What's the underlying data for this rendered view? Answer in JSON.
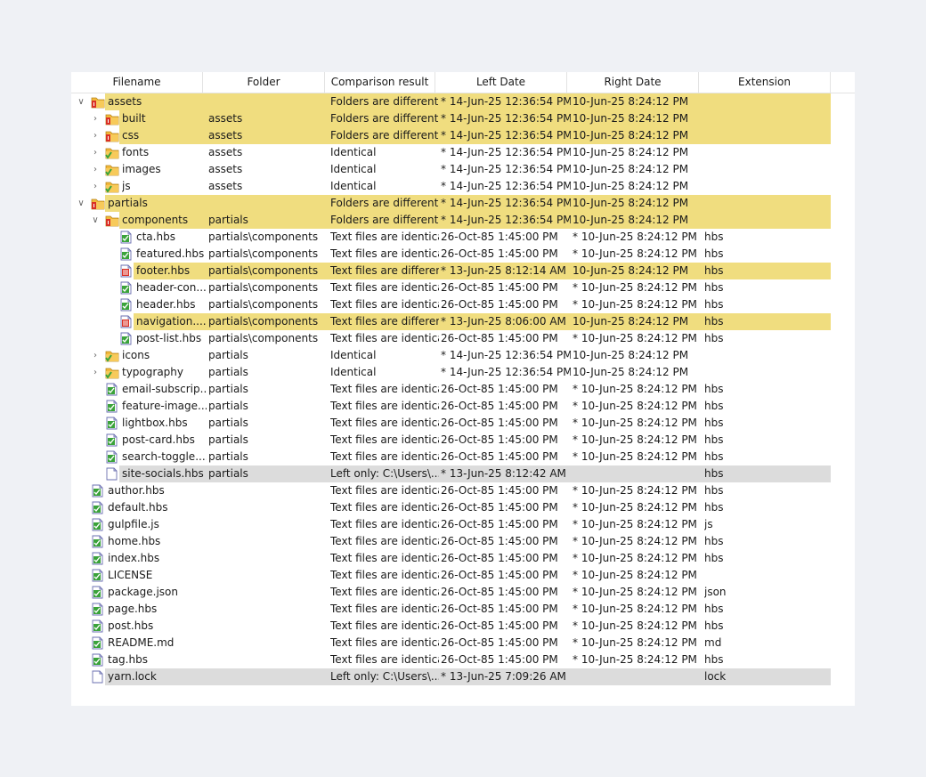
{
  "columns": [
    "Filename",
    "Folder",
    "Comparison result",
    "Left Date",
    "Right Date",
    "Extension"
  ],
  "rows": [
    {
      "level": 0,
      "toggle": "expanded",
      "icon": "folder-diff-icon",
      "name": "assets",
      "folder": "",
      "result": "Folders are different",
      "left": "* 14-Jun-25 12:36:54 PM",
      "right": "10-Jun-25 8:24:12 PM",
      "ext": "",
      "hl": "diff"
    },
    {
      "level": 1,
      "toggle": "collapsed",
      "icon": "folder-diff-icon",
      "name": "built",
      "folder": "assets",
      "result": "Folders are different",
      "left": "* 14-Jun-25 12:36:54 PM",
      "right": "10-Jun-25 8:24:12 PM",
      "ext": "",
      "hl": "diff"
    },
    {
      "level": 1,
      "toggle": "collapsed",
      "icon": "folder-diff-icon",
      "name": "css",
      "folder": "assets",
      "result": "Folders are different",
      "left": "* 14-Jun-25 12:36:54 PM",
      "right": "10-Jun-25 8:24:12 PM",
      "ext": "",
      "hl": "diff"
    },
    {
      "level": 1,
      "toggle": "collapsed",
      "icon": "folder-same-icon",
      "name": "fonts",
      "folder": "assets",
      "result": "Identical",
      "left": "* 14-Jun-25 12:36:54 PM",
      "right": "10-Jun-25 8:24:12 PM",
      "ext": "",
      "hl": ""
    },
    {
      "level": 1,
      "toggle": "collapsed",
      "icon": "folder-same-icon",
      "name": "images",
      "folder": "assets",
      "result": "Identical",
      "left": "* 14-Jun-25 12:36:54 PM",
      "right": "10-Jun-25 8:24:12 PM",
      "ext": "",
      "hl": ""
    },
    {
      "level": 1,
      "toggle": "collapsed",
      "icon": "folder-same-icon",
      "name": "js",
      "folder": "assets",
      "result": "Identical",
      "left": "* 14-Jun-25 12:36:54 PM",
      "right": "10-Jun-25 8:24:12 PM",
      "ext": "",
      "hl": ""
    },
    {
      "level": 0,
      "toggle": "expanded",
      "icon": "folder-diff-icon",
      "name": "partials",
      "folder": "",
      "result": "Folders are different",
      "left": "* 14-Jun-25 12:36:54 PM",
      "right": "10-Jun-25 8:24:12 PM",
      "ext": "",
      "hl": "diff"
    },
    {
      "level": 1,
      "toggle": "expanded",
      "icon": "folder-diff-icon",
      "name": "components",
      "folder": "partials",
      "result": "Folders are different",
      "left": "* 14-Jun-25 12:36:54 PM",
      "right": "10-Jun-25 8:24:12 PM",
      "ext": "",
      "hl": "diff"
    },
    {
      "level": 2,
      "toggle": "none",
      "icon": "file-same-icon",
      "name": "cta.hbs",
      "folder": "partials\\components",
      "result": "Text files are identical",
      "left": "26-Oct-85 1:45:00 PM",
      "right": "* 10-Jun-25 8:24:12 PM",
      "ext": "hbs",
      "hl": ""
    },
    {
      "level": 2,
      "toggle": "none",
      "icon": "file-same-icon",
      "name": "featured.hbs",
      "folder": "partials\\components",
      "result": "Text files are identical",
      "left": "26-Oct-85 1:45:00 PM",
      "right": "* 10-Jun-25 8:24:12 PM",
      "ext": "hbs",
      "hl": ""
    },
    {
      "level": 2,
      "toggle": "none",
      "icon": "file-diff-icon",
      "name": "footer.hbs",
      "folder": "partials\\components",
      "result": "Text files are different",
      "left": "* 13-Jun-25 8:12:14 AM",
      "right": "10-Jun-25 8:24:12 PM",
      "ext": "hbs",
      "hl": "diff"
    },
    {
      "level": 2,
      "toggle": "none",
      "icon": "file-same-icon",
      "name": "header-con...",
      "folder": "partials\\components",
      "result": "Text files are identical",
      "left": "26-Oct-85 1:45:00 PM",
      "right": "* 10-Jun-25 8:24:12 PM",
      "ext": "hbs",
      "hl": ""
    },
    {
      "level": 2,
      "toggle": "none",
      "icon": "file-same-icon",
      "name": "header.hbs",
      "folder": "partials\\components",
      "result": "Text files are identical",
      "left": "26-Oct-85 1:45:00 PM",
      "right": "* 10-Jun-25 8:24:12 PM",
      "ext": "hbs",
      "hl": ""
    },
    {
      "level": 2,
      "toggle": "none",
      "icon": "file-diff-icon",
      "name": "navigation....",
      "folder": "partials\\components",
      "result": "Text files are different",
      "left": "* 13-Jun-25 8:06:00 AM",
      "right": "10-Jun-25 8:24:12 PM",
      "ext": "hbs",
      "hl": "diff"
    },
    {
      "level": 2,
      "toggle": "none",
      "icon": "file-same-icon",
      "name": "post-list.hbs",
      "folder": "partials\\components",
      "result": "Text files are identical",
      "left": "26-Oct-85 1:45:00 PM",
      "right": "* 10-Jun-25 8:24:12 PM",
      "ext": "hbs",
      "hl": ""
    },
    {
      "level": 1,
      "toggle": "collapsed",
      "icon": "folder-same-icon",
      "name": "icons",
      "folder": "partials",
      "result": "Identical",
      "left": "* 14-Jun-25 12:36:54 PM",
      "right": "10-Jun-25 8:24:12 PM",
      "ext": "",
      "hl": ""
    },
    {
      "level": 1,
      "toggle": "collapsed",
      "icon": "folder-same-icon",
      "name": "typography",
      "folder": "partials",
      "result": "Identical",
      "left": "* 14-Jun-25 12:36:54 PM",
      "right": "10-Jun-25 8:24:12 PM",
      "ext": "",
      "hl": ""
    },
    {
      "level": 1,
      "toggle": "none",
      "icon": "file-same-icon",
      "name": "email-subscrip...",
      "folder": "partials",
      "result": "Text files are identical",
      "left": "26-Oct-85 1:45:00 PM",
      "right": "* 10-Jun-25 8:24:12 PM",
      "ext": "hbs",
      "hl": ""
    },
    {
      "level": 1,
      "toggle": "none",
      "icon": "file-same-icon",
      "name": "feature-image....",
      "folder": "partials",
      "result": "Text files are identical",
      "left": "26-Oct-85 1:45:00 PM",
      "right": "* 10-Jun-25 8:24:12 PM",
      "ext": "hbs",
      "hl": ""
    },
    {
      "level": 1,
      "toggle": "none",
      "icon": "file-same-icon",
      "name": "lightbox.hbs",
      "folder": "partials",
      "result": "Text files are identical",
      "left": "26-Oct-85 1:45:00 PM",
      "right": "* 10-Jun-25 8:24:12 PM",
      "ext": "hbs",
      "hl": ""
    },
    {
      "level": 1,
      "toggle": "none",
      "icon": "file-same-icon",
      "name": "post-card.hbs",
      "folder": "partials",
      "result": "Text files are identical",
      "left": "26-Oct-85 1:45:00 PM",
      "right": "* 10-Jun-25 8:24:12 PM",
      "ext": "hbs",
      "hl": ""
    },
    {
      "level": 1,
      "toggle": "none",
      "icon": "file-same-icon",
      "name": "search-toggle....",
      "folder": "partials",
      "result": "Text files are identical",
      "left": "26-Oct-85 1:45:00 PM",
      "right": "* 10-Jun-25 8:24:12 PM",
      "ext": "hbs",
      "hl": ""
    },
    {
      "level": 1,
      "toggle": "none",
      "icon": "file-left-only-icon",
      "name": "site-socials.hbs",
      "folder": "partials",
      "result": "Left only: C:\\Users\\...",
      "left": "* 13-Jun-25 8:12:42 AM",
      "right": "",
      "ext": "hbs",
      "hl": "left"
    },
    {
      "level": 0,
      "toggle": "none",
      "icon": "file-same-icon",
      "name": "author.hbs",
      "folder": "",
      "result": "Text files are identical",
      "left": "26-Oct-85 1:45:00 PM",
      "right": "* 10-Jun-25 8:24:12 PM",
      "ext": "hbs",
      "hl": ""
    },
    {
      "level": 0,
      "toggle": "none",
      "icon": "file-same-icon",
      "name": "default.hbs",
      "folder": "",
      "result": "Text files are identical",
      "left": "26-Oct-85 1:45:00 PM",
      "right": "* 10-Jun-25 8:24:12 PM",
      "ext": "hbs",
      "hl": ""
    },
    {
      "level": 0,
      "toggle": "none",
      "icon": "file-same-icon",
      "name": "gulpfile.js",
      "folder": "",
      "result": "Text files are identical",
      "left": "26-Oct-85 1:45:00 PM",
      "right": "* 10-Jun-25 8:24:12 PM",
      "ext": "js",
      "hl": ""
    },
    {
      "level": 0,
      "toggle": "none",
      "icon": "file-same-icon",
      "name": "home.hbs",
      "folder": "",
      "result": "Text files are identical",
      "left": "26-Oct-85 1:45:00 PM",
      "right": "* 10-Jun-25 8:24:12 PM",
      "ext": "hbs",
      "hl": ""
    },
    {
      "level": 0,
      "toggle": "none",
      "icon": "file-same-icon",
      "name": "index.hbs",
      "folder": "",
      "result": "Text files are identical",
      "left": "26-Oct-85 1:45:00 PM",
      "right": "* 10-Jun-25 8:24:12 PM",
      "ext": "hbs",
      "hl": ""
    },
    {
      "level": 0,
      "toggle": "none",
      "icon": "file-same-icon",
      "name": "LICENSE",
      "folder": "",
      "result": "Text files are identical",
      "left": "26-Oct-85 1:45:00 PM",
      "right": "* 10-Jun-25 8:24:12 PM",
      "ext": "",
      "hl": ""
    },
    {
      "level": 0,
      "toggle": "none",
      "icon": "file-same-icon",
      "name": "package.json",
      "folder": "",
      "result": "Text files are identical",
      "left": "26-Oct-85 1:45:00 PM",
      "right": "* 10-Jun-25 8:24:12 PM",
      "ext": "json",
      "hl": ""
    },
    {
      "level": 0,
      "toggle": "none",
      "icon": "file-same-icon",
      "name": "page.hbs",
      "folder": "",
      "result": "Text files are identical",
      "left": "26-Oct-85 1:45:00 PM",
      "right": "* 10-Jun-25 8:24:12 PM",
      "ext": "hbs",
      "hl": ""
    },
    {
      "level": 0,
      "toggle": "none",
      "icon": "file-same-icon",
      "name": "post.hbs",
      "folder": "",
      "result": "Text files are identical",
      "left": "26-Oct-85 1:45:00 PM",
      "right": "* 10-Jun-25 8:24:12 PM",
      "ext": "hbs",
      "hl": ""
    },
    {
      "level": 0,
      "toggle": "none",
      "icon": "file-same-icon",
      "name": "README.md",
      "folder": "",
      "result": "Text files are identical",
      "left": "26-Oct-85 1:45:00 PM",
      "right": "* 10-Jun-25 8:24:12 PM",
      "ext": "md",
      "hl": ""
    },
    {
      "level": 0,
      "toggle": "none",
      "icon": "file-same-icon",
      "name": "tag.hbs",
      "folder": "",
      "result": "Text files are identical",
      "left": "26-Oct-85 1:45:00 PM",
      "right": "* 10-Jun-25 8:24:12 PM",
      "ext": "hbs",
      "hl": ""
    },
    {
      "level": 0,
      "toggle": "none",
      "icon": "file-left-only-icon",
      "name": "yarn.lock",
      "folder": "",
      "result": "Left only: C:\\Users\\...",
      "left": "* 13-Jun-25 7:09:26 AM",
      "right": "",
      "ext": "lock",
      "hl": "left"
    }
  ],
  "colors": {
    "different": "#f0dd7f",
    "left_only": "#dcdcdc",
    "folder": "#f2b83a",
    "diff_mark": "#d93025",
    "same_mark": "#3aa33a"
  }
}
